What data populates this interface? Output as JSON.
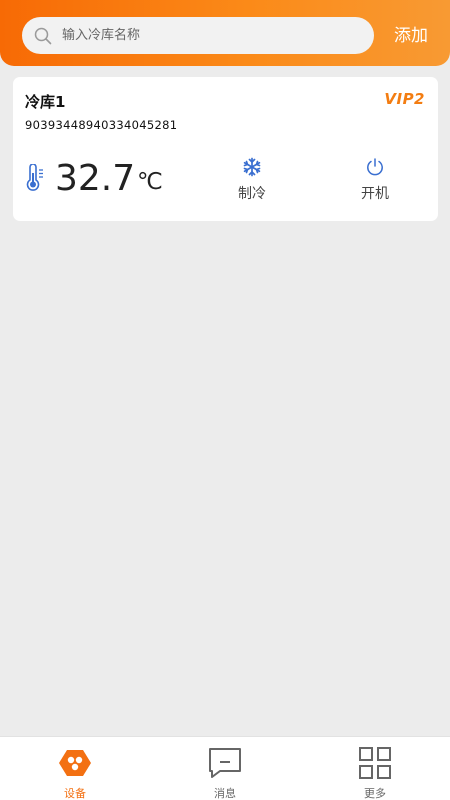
{
  "header": {
    "search_placeholder": "输入冷库名称",
    "add_label": "添加"
  },
  "device": {
    "name": "冷库1",
    "vip": "VIP2",
    "id": "90393448940334045281",
    "temperature": "32.7",
    "unit": "℃",
    "mode_label": "制冷",
    "mode_icon": "snowflake-icon",
    "power_label": "开机",
    "power_icon": "power-icon"
  },
  "tabbar": {
    "items": [
      {
        "label": "设备",
        "icon": "devices-hexagon-icon",
        "active": true
      },
      {
        "label": "消息",
        "icon": "message-icon",
        "active": false
      },
      {
        "label": "更多",
        "icon": "grid-icon",
        "active": false
      }
    ]
  },
  "colors": {
    "accent": "#f37012",
    "header_gradient_start": "#f76a05",
    "header_gradient_end": "#f89a33",
    "icon_blue": "#3a6fd0"
  }
}
